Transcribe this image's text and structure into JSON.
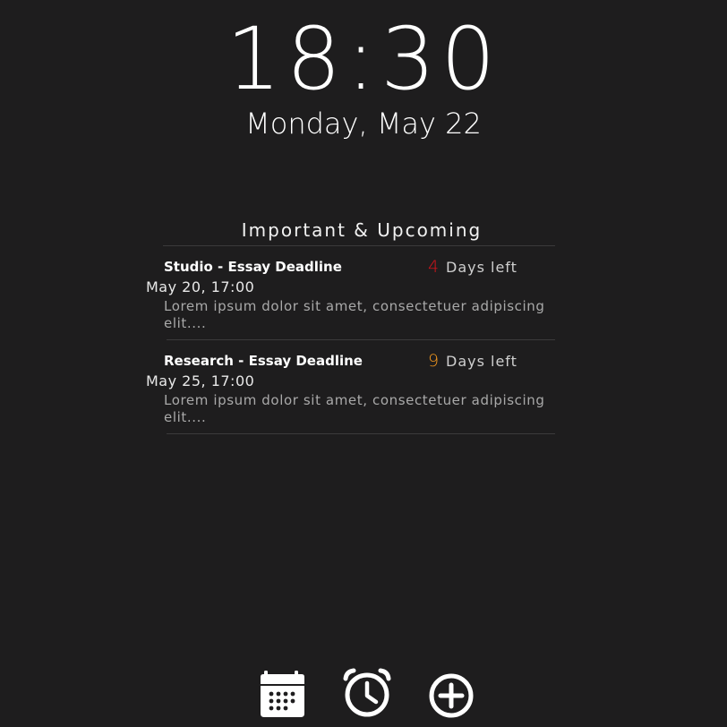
{
  "clock": {
    "time": "18:30",
    "date": "Monday, May 22"
  },
  "upcoming": {
    "title": "Important & Upcoming",
    "items": [
      {
        "title": "Studio - Essay Deadline",
        "days_count": "4",
        "days_label": "Days left",
        "days_color": "#d6141c",
        "when": "May 20, 17:00",
        "description": "Lorem ipsum dolor sit amet, consectetuer adipiscing elit...."
      },
      {
        "title": "Research - Essay Deadline",
        "days_count": "9",
        "days_label": "Days left",
        "days_color": "#f0961e",
        "when": "May 25, 17:00",
        "description": "Lorem ipsum dolor sit amet, consectetuer adipiscing elit...."
      }
    ]
  },
  "dock": {
    "buttons": [
      {
        "name": "calendar-icon",
        "label": "Calendar"
      },
      {
        "name": "alarm-clock-icon",
        "label": "Alarm"
      },
      {
        "name": "add-circle-icon",
        "label": "Add"
      }
    ]
  },
  "colors": {
    "background": "#1e1d1e",
    "text": "#ffffff",
    "urgent": "#d6141c",
    "warning": "#f0961e"
  }
}
